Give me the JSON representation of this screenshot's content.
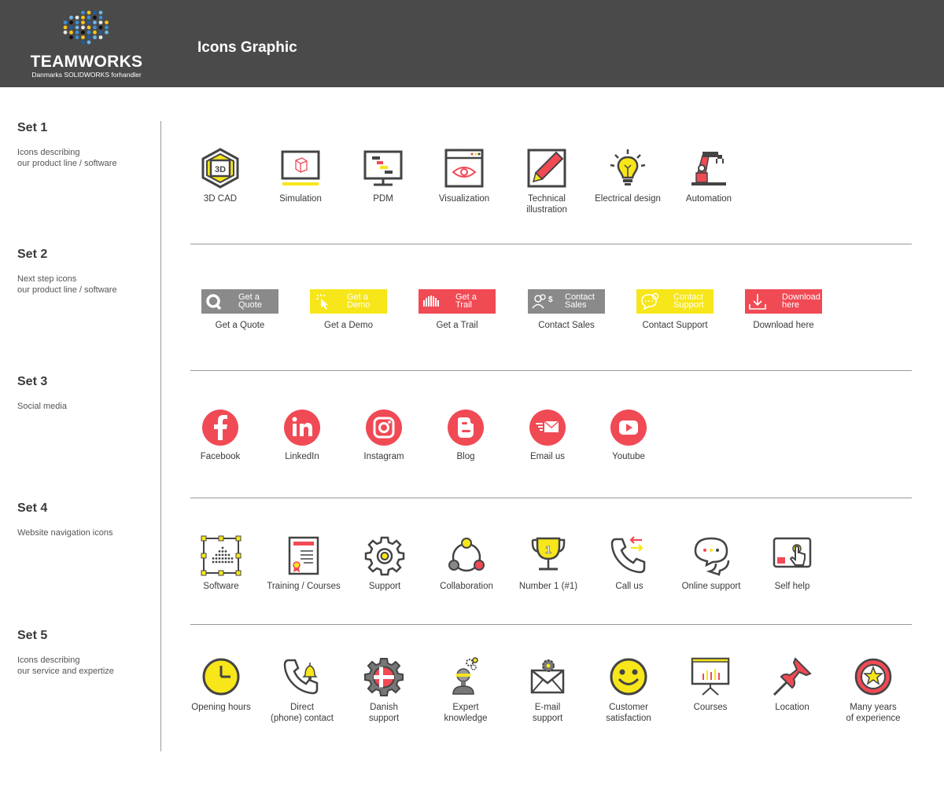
{
  "header": {
    "logo_text": "TEAMWORKS",
    "logo_sub": "Danmarks SOLIDWORKS forhandler",
    "title": "Icons Graphic"
  },
  "colors": {
    "header_bg": "#4a4a4a",
    "accent_red": "#f04a55",
    "accent_yellow": "#f7e619",
    "icon_gray": "#444444",
    "button_gray": "#8a8a8a"
  },
  "sets": [
    {
      "title": "Set 1",
      "desc": [
        "Icons describing",
        "our product line / software"
      ],
      "items": [
        {
          "label": "3D CAD",
          "icon": "3d-cad-icon"
        },
        {
          "label": "Simulation",
          "icon": "simulation-icon"
        },
        {
          "label": "PDM",
          "icon": "pdm-icon"
        },
        {
          "label": "Visualization",
          "icon": "visualization-icon"
        },
        {
          "label": "Technical illustration",
          "icon": "technical-illustration-icon"
        },
        {
          "label": "Electrical design",
          "icon": "electrical-design-icon"
        },
        {
          "label": "Automation",
          "icon": "automation-icon"
        }
      ]
    },
    {
      "title": "Set 2",
      "desc": [
        "Next step icons",
        "our product line / software"
      ],
      "items": [
        {
          "label": "Get a Quote",
          "btn1": "Get a",
          "btn2": "Quote",
          "icon": "quote-icon"
        },
        {
          "label": "Get a Demo",
          "btn1": "Get a",
          "btn2": "Demo",
          "icon": "demo-icon"
        },
        {
          "label": "Get a Trail",
          "btn1": "Get a",
          "btn2": "Trail",
          "icon": "trail-icon"
        },
        {
          "label": "Contact Sales",
          "btn1": "Contact",
          "btn2": "Sales",
          "icon": "contact-sales-icon"
        },
        {
          "label": "Contact Support",
          "btn1": "Contact",
          "btn2": "Support",
          "icon": "contact-support-icon"
        },
        {
          "label": "Download here",
          "btn1": "Download",
          "btn2": "here",
          "icon": "download-icon"
        }
      ]
    },
    {
      "title": "Set 3",
      "desc": [
        "Social media"
      ],
      "items": [
        {
          "label": "Facebook",
          "icon": "facebook-icon"
        },
        {
          "label": "LinkedIn",
          "icon": "linkedin-icon"
        },
        {
          "label": "Instagram",
          "icon": "instagram-icon"
        },
        {
          "label": "Blog",
          "icon": "blog-icon"
        },
        {
          "label": "Email us",
          "icon": "email-icon"
        },
        {
          "label": "Youtube",
          "icon": "youtube-icon"
        }
      ]
    },
    {
      "title": "Set 4",
      "desc": [
        "Website navigation icons"
      ],
      "items": [
        {
          "label": "Software",
          "icon": "software-icon"
        },
        {
          "label": "Training / Courses",
          "icon": "training-icon"
        },
        {
          "label": "Support",
          "icon": "support-gear-icon"
        },
        {
          "label": "Collaboration",
          "icon": "collaboration-icon"
        },
        {
          "label": "Number 1 (#1)",
          "icon": "trophy-icon"
        },
        {
          "label": "Call us",
          "icon": "call-us-icon"
        },
        {
          "label": "Online support",
          "icon": "online-support-icon"
        },
        {
          "label": "Self help",
          "icon": "self-help-icon"
        }
      ]
    },
    {
      "title": "Set 5",
      "desc": [
        "Icons describing",
        "our service and expertize"
      ],
      "items": [
        {
          "label": "Opening hours",
          "icon": "clock-icon"
        },
        {
          "label": "Direct (phone) contact",
          "l1": "Direct",
          "l2": "(phone) contact",
          "icon": "phone-bell-icon"
        },
        {
          "label": "Danish support",
          "l1": "Danish",
          "l2": "support",
          "icon": "danish-gear-icon"
        },
        {
          "label": "Expert knowledge",
          "l1": "Expert",
          "l2": "knowledge",
          "icon": "expert-icon"
        },
        {
          "label": "E-mail support",
          "l1": "E-mail",
          "l2": "support",
          "icon": "email-gear-icon"
        },
        {
          "label": "Customer satisfaction",
          "l1": "Customer",
          "l2": "satisfaction",
          "icon": "smiley-icon"
        },
        {
          "label": "Courses",
          "icon": "presentation-icon"
        },
        {
          "label": "Location",
          "icon": "pushpin-icon"
        },
        {
          "label": "Many years of experience",
          "l1": "Many years",
          "l2": "of experience",
          "icon": "star-badge-icon"
        }
      ]
    }
  ]
}
